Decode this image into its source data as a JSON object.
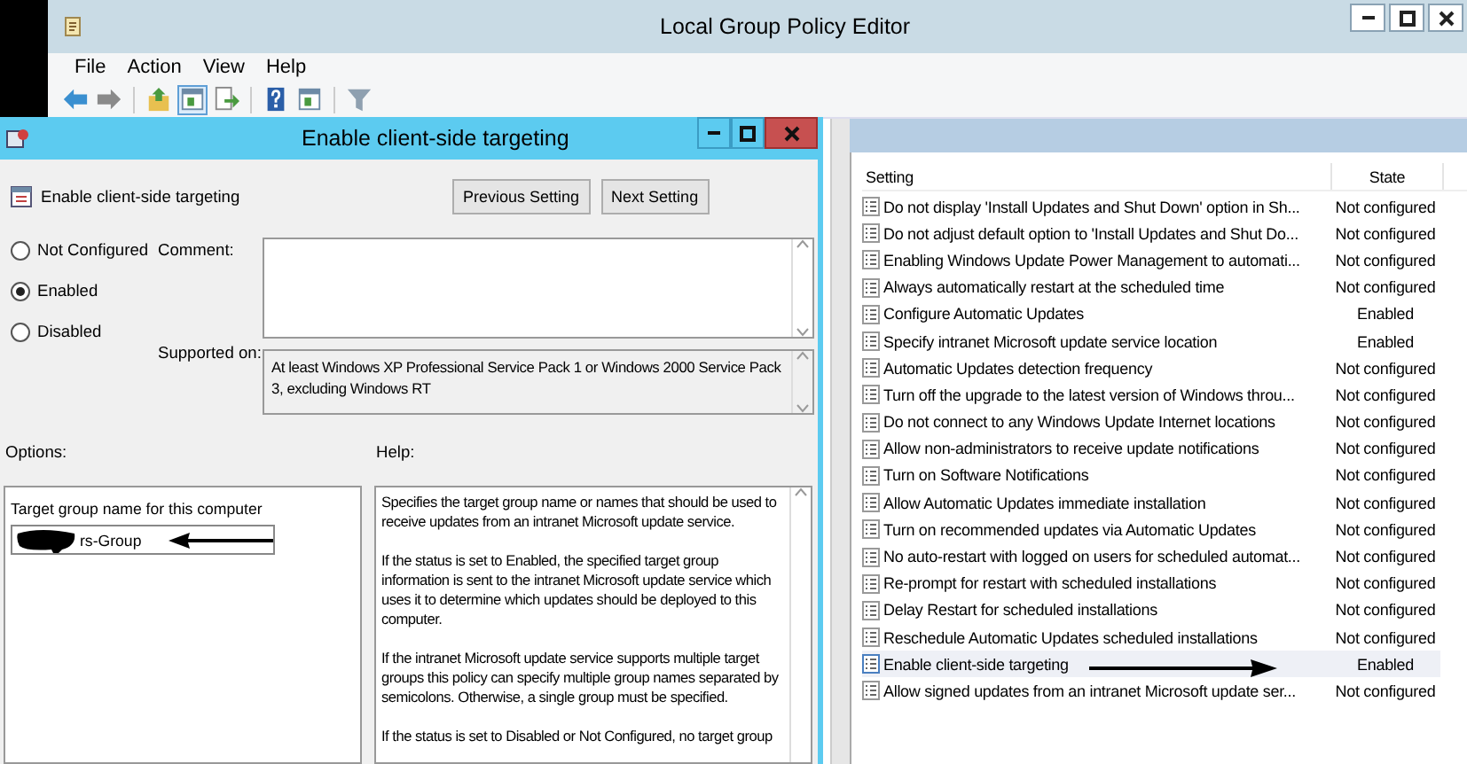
{
  "main_window": {
    "title": "Local Group Policy Editor",
    "menu": [
      "File",
      "Action",
      "View",
      "Help"
    ],
    "toolbar": [
      {
        "kind": "back",
        "selected": false
      },
      {
        "kind": "forward",
        "selected": false
      },
      {
        "kind": "up",
        "selected": false
      },
      {
        "kind": "pane",
        "selected": true
      },
      {
        "kind": "export",
        "selected": false
      },
      {
        "kind": "help",
        "selected": false
      },
      {
        "kind": "pane",
        "selected": false
      },
      {
        "kind": "filter",
        "selected": false
      }
    ],
    "settings_list": {
      "columns": [
        "Setting",
        "State"
      ],
      "rows": [
        {
          "setting": "Do not display 'Install Updates and Shut Down' option in Sh...",
          "state": "Not configured",
          "selected": false
        },
        {
          "setting": "Do not adjust default option to 'Install Updates and Shut Do...",
          "state": "Not configured",
          "selected": false
        },
        {
          "setting": "Enabling Windows Update Power Management to automati...",
          "state": "Not configured",
          "selected": false
        },
        {
          "setting": "Always automatically restart at the scheduled time",
          "state": "Not configured",
          "selected": false
        },
        {
          "setting": "Configure Automatic Updates",
          "state": "Enabled",
          "selected": false
        },
        {
          "setting": "Specify intranet Microsoft update service location",
          "state": "Enabled",
          "selected": false
        },
        {
          "setting": "Automatic Updates detection frequency",
          "state": "Not configured",
          "selected": false
        },
        {
          "setting": "Turn off the upgrade to the latest version of Windows throu...",
          "state": "Not configured",
          "selected": false
        },
        {
          "setting": "Do not connect to any Windows Update Internet locations",
          "state": "Not configured",
          "selected": false
        },
        {
          "setting": "Allow non-administrators to receive update notifications",
          "state": "Not configured",
          "selected": false
        },
        {
          "setting": "Turn on Software Notifications",
          "state": "Not configured",
          "selected": false
        },
        {
          "setting": "Allow Automatic Updates immediate installation",
          "state": "Not configured",
          "selected": false
        },
        {
          "setting": "Turn on recommended updates via Automatic Updates",
          "state": "Not configured",
          "selected": false
        },
        {
          "setting": "No auto-restart with logged on users for scheduled automat...",
          "state": "Not configured",
          "selected": false
        },
        {
          "setting": "Re-prompt for restart with scheduled installations",
          "state": "Not configured",
          "selected": false
        },
        {
          "setting": "Delay Restart for scheduled installations",
          "state": "Not configured",
          "selected": false
        },
        {
          "setting": "Reschedule Automatic Updates scheduled installations",
          "state": "Not configured",
          "selected": false
        },
        {
          "setting": "Enable client-side targeting",
          "state": "Enabled",
          "selected": true
        },
        {
          "setting": "Allow signed updates from an intranet Microsoft update ser...",
          "state": "Not configured",
          "selected": false
        }
      ]
    }
  },
  "dialog": {
    "title": "Enable client-side targeting",
    "policy_name": "Enable client-side targeting",
    "buttons": [
      "Previous Setting",
      "Next Setting"
    ],
    "states": [
      {
        "label": "Not Configured",
        "selected": false
      },
      {
        "label": "Enabled",
        "selected": true
      },
      {
        "label": "Disabled",
        "selected": false
      }
    ],
    "comment_label": "Comment:",
    "supported_label": "Supported on:",
    "supported_text": "At least Windows XP Professional Service Pack 1 or Windows 2000 Service Pack 3, excluding Windows RT",
    "options_label": "Options:",
    "help_label": "Help:",
    "target_label": "Target group name for this computer",
    "target_value": "rs-Group",
    "help_paragraphs": [
      "Specifies the target group name or names that should be used to receive updates from an intranet Microsoft update service.",
      "If the status is set to Enabled, the specified target group information is sent to the intranet Microsoft update service which uses it to determine which updates should be deployed to this computer.",
      "If the intranet Microsoft update service supports multiple target groups this policy can specify multiple group names separated by semicolons. Otherwise, a single group must be specified.",
      "If the status is set to Disabled or Not Configured, no target group"
    ]
  }
}
